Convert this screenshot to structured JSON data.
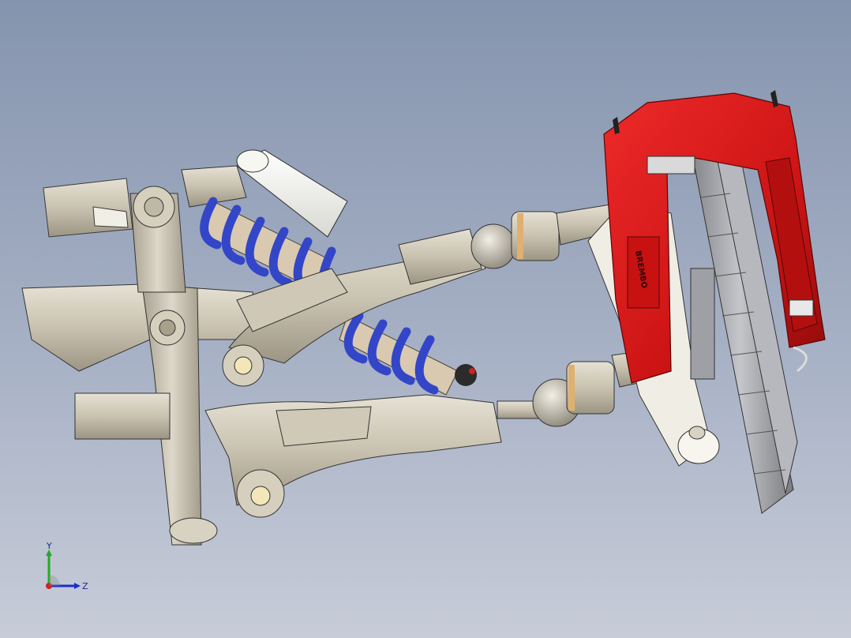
{
  "viewport": {
    "background_top": "#8594ae",
    "background_bottom": "#c7ccd8"
  },
  "model": {
    "caliper_color": "#d21616",
    "spring_color": "#3346c8",
    "metal_color": "#cfc8b6",
    "damper_body_color": "#f4f4f0"
  },
  "caliper_text": "BREMBO",
  "triad": {
    "y_label": "Y",
    "z_label": "Z",
    "y_color": "#22aa22",
    "z_color": "#1b2fd0",
    "x_color": "#cc2222"
  }
}
